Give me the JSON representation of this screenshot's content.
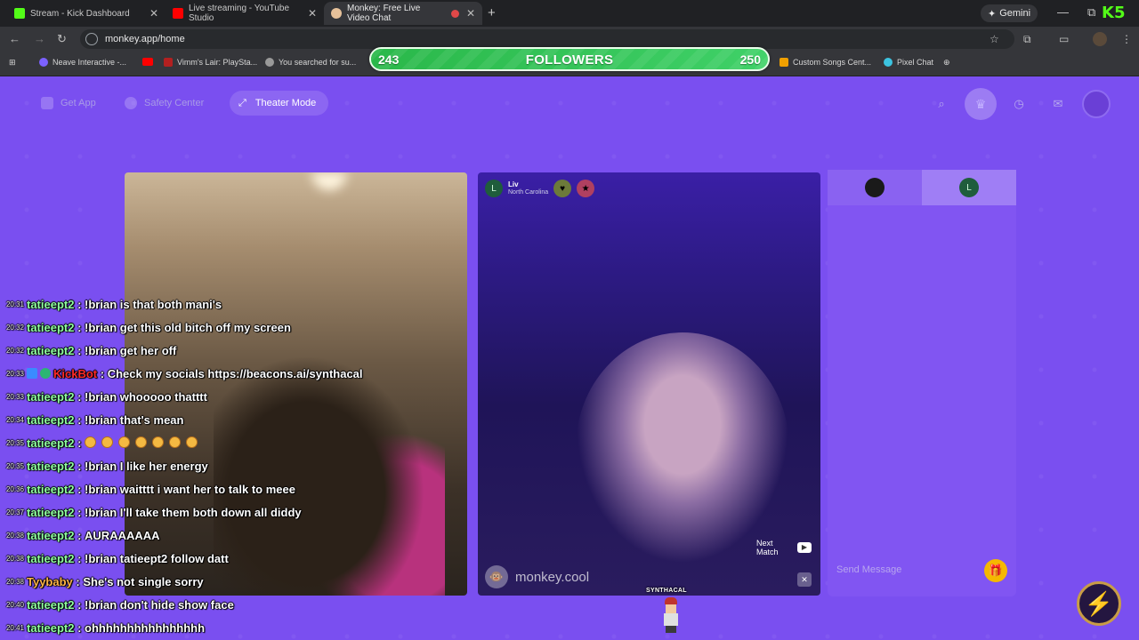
{
  "browser": {
    "tabs": [
      {
        "title": "Stream - Kick Dashboard",
        "favicon_color": "#53fc18",
        "active": false
      },
      {
        "title": "Live streaming - YouTube Studio",
        "favicon_color": "#ff0000",
        "active": false
      },
      {
        "title": "Monkey: Free Live Video Chat",
        "favicon_color": "#e6c19a",
        "active": true
      }
    ],
    "new_tab": "+",
    "gemini_label": "Gemini",
    "url": "monkey.app/home",
    "bookmarks": [
      {
        "label": "Neave Interactive -...",
        "color": "#7b61ff"
      },
      {
        "label": "",
        "color": "#ff0000"
      },
      {
        "label": "Vimm's Lair: PlaySta...",
        "color": "#b32020"
      },
      {
        "label": "You searched for su...",
        "color": "#999999"
      },
      {
        "label": "Custom Songs Cent...",
        "color": "#f0a000"
      },
      {
        "label": "Pixel Chat",
        "color": "#3cc3e0"
      }
    ]
  },
  "overlay": {
    "goal_current": "243",
    "goal_label": "FOLLOWERS",
    "goal_target": "250",
    "progress": 0.972,
    "colors": {
      "bar": "#3fd067",
      "border": "#eaffea"
    }
  },
  "app": {
    "header": {
      "get_app": "Get App",
      "safety_center": "Safety Center",
      "theater_mode": "Theater Mode"
    },
    "peer": {
      "initial": "L",
      "name": "Liv",
      "location": "North Carolina"
    },
    "next_match": "Next Match",
    "watermark": "monkey.cool",
    "chat_tab_initial": "L",
    "send_placeholder": "Send Message",
    "accent": "#7a4ff0"
  },
  "sprite_name": "SYNTHACAL",
  "stream_chat": [
    {
      "ts": "20:31",
      "user": "tatieept2",
      "color": "#8fffa0",
      "msg": "!brian is that both mani's"
    },
    {
      "ts": "20:32",
      "user": "tatieept2",
      "color": "#8fffa0",
      "msg": "!brian get this old bitch off my screen"
    },
    {
      "ts": "20:32",
      "user": "tatieept2",
      "color": "#8fffa0",
      "msg": "!brian get her off"
    },
    {
      "ts": "20:33",
      "user": "KickBot",
      "color": "#ff2a2a",
      "msg": "Check my socials https://beacons.ai/synthacal",
      "bot": true
    },
    {
      "ts": "20:33",
      "user": "tatieept2",
      "color": "#8fffa0",
      "msg": "!brian whooooo thatttt"
    },
    {
      "ts": "20:34",
      "user": "tatieept2",
      "color": "#8fffa0",
      "msg": "!brian that's mean"
    },
    {
      "ts": "20:35",
      "user": "tatieept2",
      "color": "#8fffa0",
      "msg": "",
      "emojis": 7
    },
    {
      "ts": "20:35",
      "user": "tatieept2",
      "color": "#8fffa0",
      "msg": "!brian I like her energy"
    },
    {
      "ts": "20:36",
      "user": "tatieept2",
      "color": "#8fffa0",
      "msg": "!brian waitttt i want her to talk to meee"
    },
    {
      "ts": "20:37",
      "user": "tatieept2",
      "color": "#8fffa0",
      "msg": "!brian I'll take them both down all diddy"
    },
    {
      "ts": "20:38",
      "user": "tatieept2",
      "color": "#8fffa0",
      "msg": "AURAAAAAA"
    },
    {
      "ts": "20:38",
      "user": "tatieept2",
      "color": "#8fffa0",
      "msg": "!brian tatieept2 follow datt"
    },
    {
      "ts": "20:38",
      "user": "Tyybaby",
      "color": "#ffb347",
      "msg": "She's not single sorry"
    },
    {
      "ts": "20:40",
      "user": "tatieept2",
      "color": "#8fffa0",
      "msg": "!brian don't hide show face"
    },
    {
      "ts": "20:41",
      "user": "tatieept2",
      "color": "#8fffa0",
      "msg": "ohhhhhhhhhhhhhhhh"
    }
  ]
}
